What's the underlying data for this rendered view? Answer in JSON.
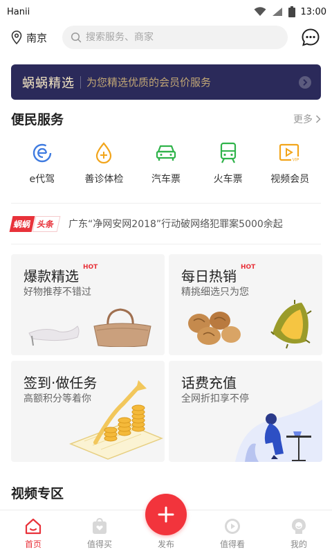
{
  "status_bar": {
    "carrier": "Hanii",
    "time": "13:00"
  },
  "header": {
    "location": "南京",
    "search_placeholder": "搜索服务、商家",
    "message_icon": "message-icon"
  },
  "banner": {
    "title": "蜗蜗精选",
    "subtitle": "为您精选优质的会员价服务"
  },
  "convenience": {
    "title": "便民服务",
    "more": "更多",
    "items": [
      {
        "label": "e代驾",
        "icon": "e-driver-icon",
        "color": "#3f7be0"
      },
      {
        "label": "善诊体检",
        "icon": "checkup-icon",
        "color": "#f2a51b"
      },
      {
        "label": "汽车票",
        "icon": "bus-icon",
        "color": "#2fb34a"
      },
      {
        "label": "火车票",
        "icon": "train-icon",
        "color": "#2fb34a"
      },
      {
        "label": "视频会员",
        "icon": "video-vip-icon",
        "color": "#f2a51b"
      }
    ]
  },
  "news": {
    "logo_left": "蜗蜗",
    "logo_right": "头条",
    "headline": "广东“净网安网2018”行动破网络犯罪案5000余起"
  },
  "cards": [
    {
      "title": "爆款精选",
      "tag": "HOT",
      "subtitle": "好物推荐不错过"
    },
    {
      "title": "每日热销",
      "tag": "HOT",
      "subtitle": "精挑细选只为您"
    },
    {
      "title": "签到·做任务",
      "subtitle": "高额积分等着你"
    },
    {
      "title": "话费充值",
      "subtitle": "全网折扣享不停"
    }
  ],
  "video_zone": {
    "title": "视频专区"
  },
  "tabbar": {
    "items": [
      {
        "label": "首页",
        "icon": "home-icon",
        "active": true
      },
      {
        "label": "值得买",
        "icon": "shopping-bag-icon",
        "active": false
      },
      {
        "label": "发布",
        "icon": "plus-icon",
        "active": false
      },
      {
        "label": "值得看",
        "icon": "play-icon",
        "active": false
      },
      {
        "label": "我的",
        "icon": "profile-icon",
        "active": false
      }
    ]
  },
  "colors": {
    "accent": "#e8323a",
    "banner_bg": "#2b2a5a",
    "banner_gold": "#c2a775"
  }
}
